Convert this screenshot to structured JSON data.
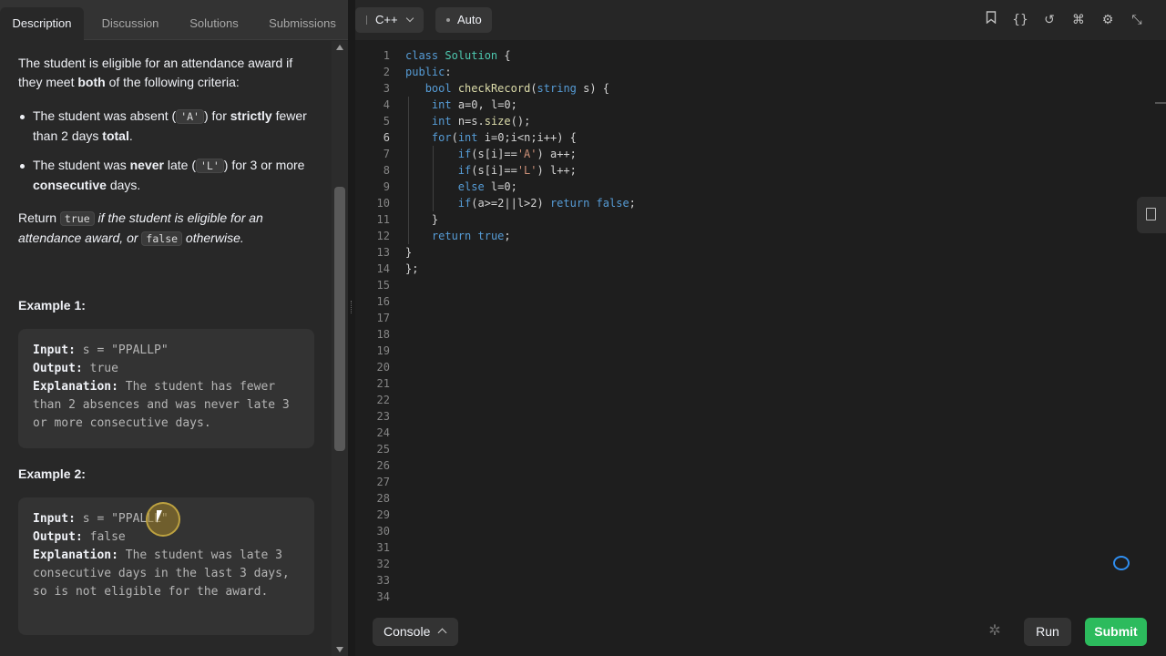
{
  "tabs": {
    "description": "Description",
    "discussion": "Discussion",
    "solutions": "Solutions",
    "submissions": "Submissions"
  },
  "problem": {
    "intro_1": "The student is eligible for an attendance award if they meet ",
    "intro_both": "both",
    "intro_2": " of the following criteria:",
    "bullet1": {
      "pre": "The student was absent (",
      "code": "'A'",
      "mid": ") for ",
      "strictly": "strictly",
      "post": " fewer than 2 days ",
      "total": "total",
      "end": "."
    },
    "bullet2": {
      "pre": "The student was ",
      "never": "never",
      "mid": " late (",
      "code": "'L'",
      "post": ") for 3 or more ",
      "consecutive": "consecutive",
      "end": " days."
    },
    "return": {
      "pre": "Return ",
      "true_code": "true",
      "mid": " if the student is eligible for an attendance award, or ",
      "false_code": "false",
      "post": " otherwise."
    }
  },
  "examples": [
    {
      "title": "Example 1:",
      "input_label": "Input:",
      "input": " s = \"PPALLP\"",
      "output_label": "Output:",
      "output": " true",
      "explanation_label": "Explanation:",
      "explanation": " The student has fewer than 2 absences and was never late 3 or more consecutive days."
    },
    {
      "title": "Example 2:",
      "input_label": "Input:",
      "input": " s = \"PPALLL\"",
      "output_label": "Output:",
      "output": " false",
      "explanation_label": "Explanation:",
      "explanation": " The student was late 3 consecutive days in the last 3 days, so is not eligible for the award."
    }
  ],
  "editor": {
    "language": "C++",
    "mode": "Auto",
    "toolbar_icons": [
      "bookmark-icon",
      "braces-icon",
      "reset-icon",
      "command-icon",
      "settings-icon",
      "collapse-icon"
    ],
    "line_count": 34,
    "current_line": 6
  },
  "bottom": {
    "console": "Console",
    "run": "Run",
    "submit": "Submit"
  },
  "colors": {
    "submit_green": "#2cbb5d",
    "keyword_blue": "#569cd6",
    "chat_blue": "#2f8ef0"
  }
}
